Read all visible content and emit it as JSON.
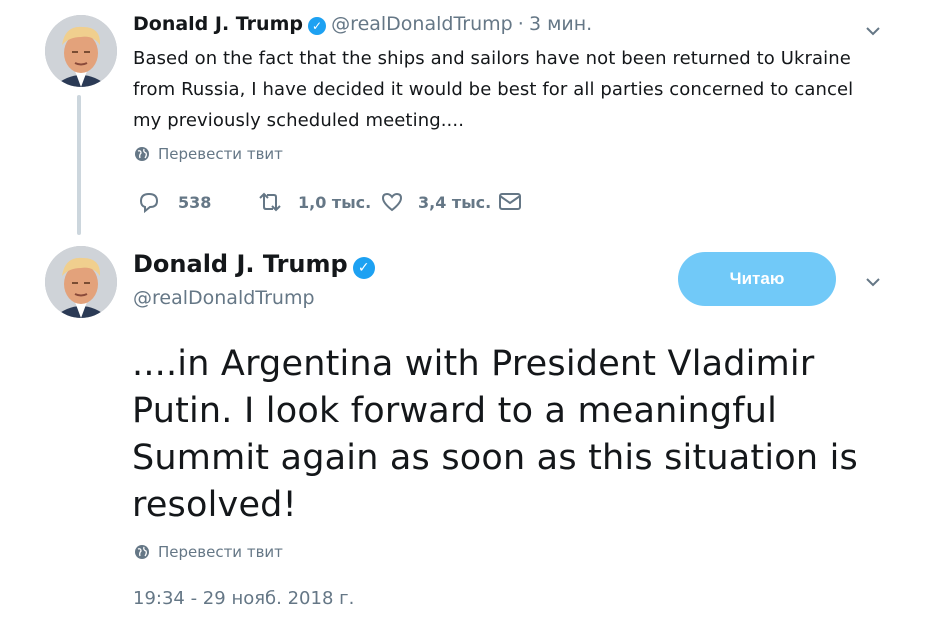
{
  "tweet1": {
    "author_name": "Donald J. Trump",
    "handle": "@realDonaldTrump",
    "separator": "·",
    "time": "3 мин.",
    "text_lines": [
      "Based on the fact that the ships and sailors have not been returned to Ukraine",
      "from Russia, I have decided it would be best for all parties concerned to cancel",
      "my previously scheduled meeting...."
    ],
    "translate_label": "Перевести твит",
    "actions": {
      "reply_count": "538",
      "retweet_count": "1,0 тыс.",
      "like_count": "3,4 тыс."
    }
  },
  "tweet2": {
    "author_name": "Donald J. Trump",
    "handle": "@realDonaldTrump",
    "follow_button_label": "Читаю",
    "text_lines": [
      "....in Argentina with President Vladimir",
      "Putin. I look forward to a meaningful",
      "Summit again as soon as this situation is",
      "resolved!"
    ],
    "translate_label": "Перевести твит",
    "timestamp": "19:34 - 29 нояб. 2018 г."
  },
  "colors": {
    "accent_blue": "#1da1f2",
    "follow_button_bg": "#71c9f8",
    "muted_text": "#657786",
    "thread_line": "#ccd6dd"
  },
  "icons": [
    "verified-icon",
    "chevron-down-icon",
    "globe-icon",
    "reply-icon",
    "retweet-icon",
    "like-icon",
    "dm-icon"
  ]
}
